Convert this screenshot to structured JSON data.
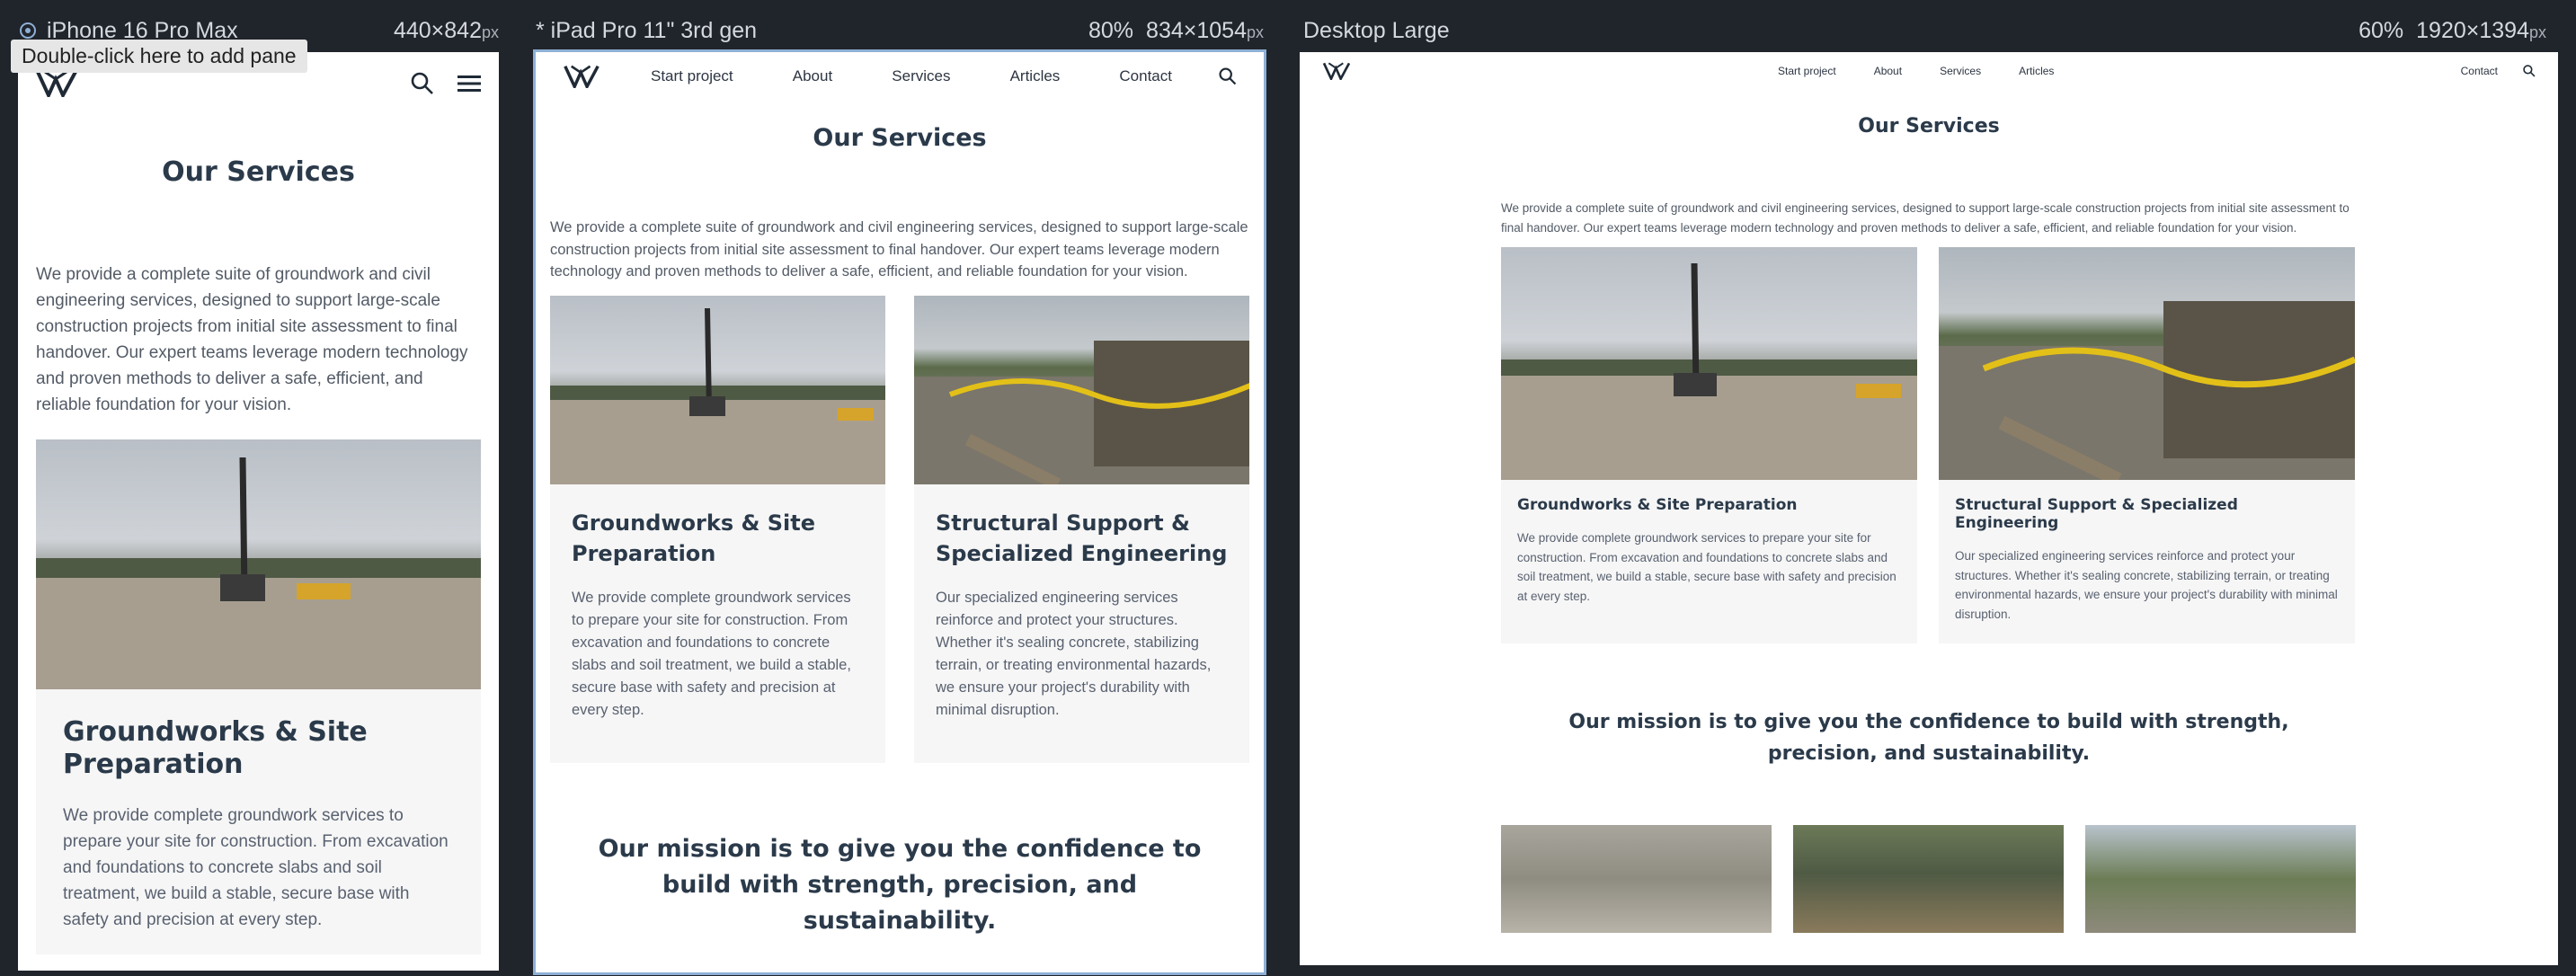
{
  "app": {
    "tooltip": "Double-click here to add pane",
    "px_unit": "px"
  },
  "panes": {
    "iphone": {
      "device": "iPhone 16 Pro Max",
      "size": "440×842"
    },
    "ipad": {
      "device": "* iPad Pro 11\" 3rd gen",
      "zoom": "80%",
      "size": "834×1054"
    },
    "desktop": {
      "device": "Desktop Large",
      "zoom": "60%",
      "size": "1920×1394"
    }
  },
  "nav": {
    "start_project": "Start project",
    "about": "About",
    "services": "Services",
    "articles": "Articles",
    "contact": "Contact"
  },
  "page": {
    "title": "Our Services",
    "intro": "We provide a complete suite of groundwork and civil engineering services, designed to support large-scale construction projects from initial site assessment to final handover. Our expert teams leverage modern technology and proven methods to deliver a safe, efficient, and reliable foundation for your vision.",
    "mission": "Our mission is to give you the confidence to build with strength, precision, and sustainability."
  },
  "services": [
    {
      "title": "Groundworks & Site Preparation",
      "body": "We provide complete groundwork services to prepare your site for construction. From excavation and foundations to concrete slabs and soil treatment, we build a stable, secure base with safety and precision at every step."
    },
    {
      "title": "Structural Support & Specialized Engineering",
      "body": "Our specialized engineering services reinforce and protect your structures. Whether it's sealing concrete, stabilizing terrain, or treating environmental hazards, we ensure your project's durability with minimal disruption."
    }
  ],
  "colors": {
    "app_bg": "#20242b",
    "heading": "#2b3a4a",
    "card_bg": "#f6f6f6",
    "active_border": "#8fb0d6"
  }
}
